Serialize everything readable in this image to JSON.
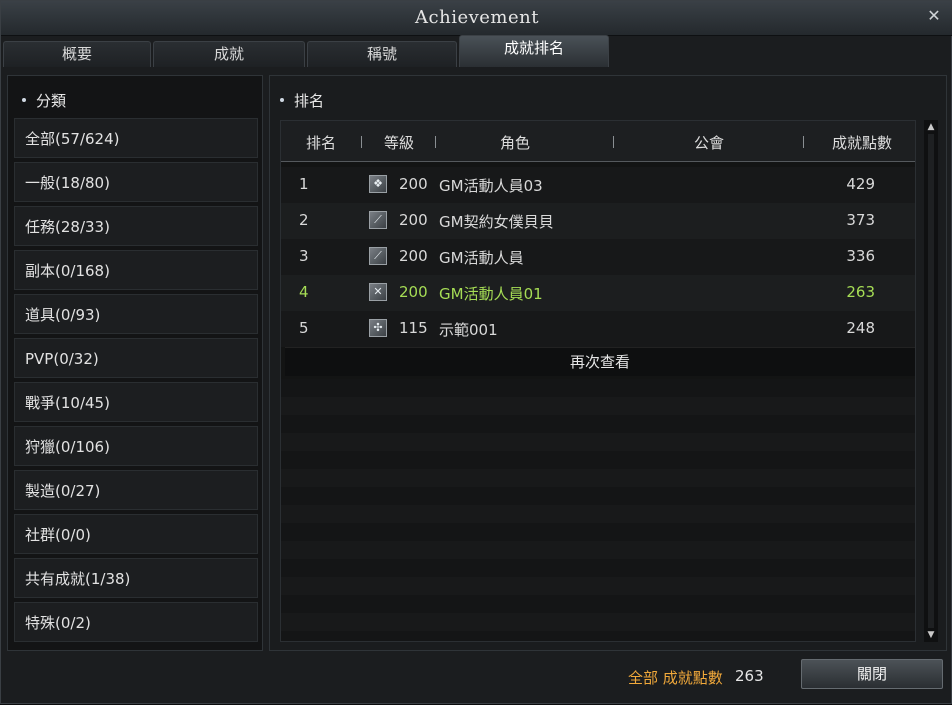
{
  "window": {
    "title": "Achievement",
    "close_icon": "close-icon"
  },
  "tabs": [
    {
      "label": "概要"
    },
    {
      "label": "成就"
    },
    {
      "label": "稱號"
    },
    {
      "label": "成就排名",
      "active": true
    }
  ],
  "categories": {
    "title": "分類",
    "items": [
      {
        "label": "全部(57/624)"
      },
      {
        "label": "一般(18/80)"
      },
      {
        "label": "任務(28/33)"
      },
      {
        "label": "副本(0/168)"
      },
      {
        "label": "道具(0/93)"
      },
      {
        "label": "PVP(0/32)"
      },
      {
        "label": "戰爭(10/45)"
      },
      {
        "label": "狩獵(0/106)"
      },
      {
        "label": "製造(0/27)"
      },
      {
        "label": "社群(0/0)"
      },
      {
        "label": "共有成就(1/38)"
      },
      {
        "label": "特殊(0/2)"
      }
    ]
  },
  "ranking": {
    "title": "排名",
    "columns": [
      "排名",
      "等級",
      "角色",
      "公會",
      "成就點數"
    ],
    "rows": [
      {
        "rank": "1",
        "icon": "class-icon",
        "level": "200",
        "name": "GM活動人員03",
        "guild": "",
        "points": "429"
      },
      {
        "rank": "2",
        "icon": "class-icon",
        "level": "200",
        "name": "GM契約女僕貝貝",
        "guild": "",
        "points": "373"
      },
      {
        "rank": "3",
        "icon": "class-icon",
        "level": "200",
        "name": "GM活動人員",
        "guild": "",
        "points": "336"
      },
      {
        "rank": "4",
        "icon": "class-icon",
        "level": "200",
        "name": "GM活動人員01",
        "guild": "",
        "points": "263",
        "highlight": true,
        "highlight_color": "#a6dd55"
      },
      {
        "rank": "5",
        "icon": "class-icon",
        "level": "115",
        "name": "示範001",
        "guild": "",
        "points": "248"
      }
    ],
    "view_again": "再次查看"
  },
  "footer": {
    "total_label": "全部 成就點數",
    "total_value": "263",
    "close_label": "關閉",
    "total_label_color": "#f0a83a"
  }
}
